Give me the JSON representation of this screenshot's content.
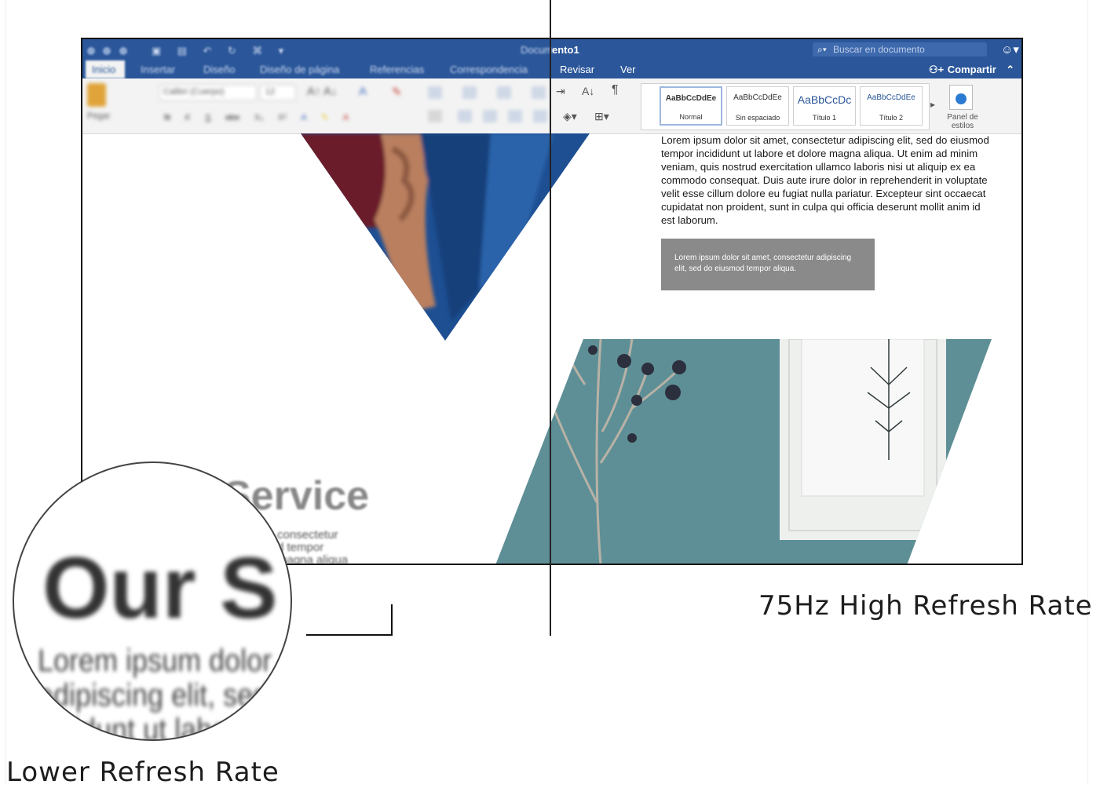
{
  "window": {
    "title": "ento1",
    "title_blurred": "Docum",
    "search_placeholder": "Buscar en documento",
    "share_label": "Compartir"
  },
  "tabs_blurred": [
    "Inicio",
    "Insertar",
    "Diseño",
    "Diseño de página",
    "Referencias",
    "Correspondencia"
  ],
  "tabs_sharp": [
    "Revisar",
    "Ver"
  ],
  "ribbon_left": {
    "paste_label": "Pegar",
    "font_name": "Calibri (Cuerpo)",
    "font_size": "12",
    "format_buttons": [
      "N",
      "K",
      "S",
      "abe",
      "X₂",
      "X²"
    ]
  },
  "styles": [
    {
      "preview": "AaBbCcDdEe",
      "name": "Normal"
    },
    {
      "preview": "AaBbCcDdEe",
      "name": "Sin espaciado"
    },
    {
      "preview": "AaBbCcDc",
      "name": "Título 1"
    },
    {
      "preview": "AaBbCcDdEe",
      "name": "Título 2"
    }
  ],
  "styles_panel_label": "Panel de estilos",
  "document": {
    "paragraph": "Lorem ipsum dolor sit amet, consectetur adipiscing elit, sed do eiusmod tempor incididunt ut labore et dolore magna aliqua. Ut enim ad minim veniam, quis nostrud exercitation ullamco laboris nisi ut aliquip ex ea commodo consequat. Duis aute irure dolor in reprehenderit in voluptate velit esse cillum dolore eu fugiat nulla pariatur. Excepteur sint occaecat cupidatat non proident, sunt in culpa qui officia deserunt mollit anim id est laborum.",
    "callout": "Lorem ipsum dolor sit amet, consectetur adipiscing elit, sed do eiusmod tempor aliqua.",
    "service_heading": "Service",
    "service_text": [
      "consectetur",
      "d tempor",
      "magna aliqua"
    ]
  },
  "magnifier": {
    "heading": "Our S",
    "lines": [
      "Lorem ipsum dolor sit",
      "adipiscing elit, sed d",
      "cididunt ut labor"
    ]
  },
  "captions": {
    "right": "75Hz High Refresh Rate",
    "left": "Lower Refresh Rate"
  },
  "colors": {
    "ribbon_blue": "#2b579a",
    "teal_wall": "#5e8f96",
    "navy_fabric": "#1f4e8c",
    "burgundy": "#7a1f2a"
  }
}
